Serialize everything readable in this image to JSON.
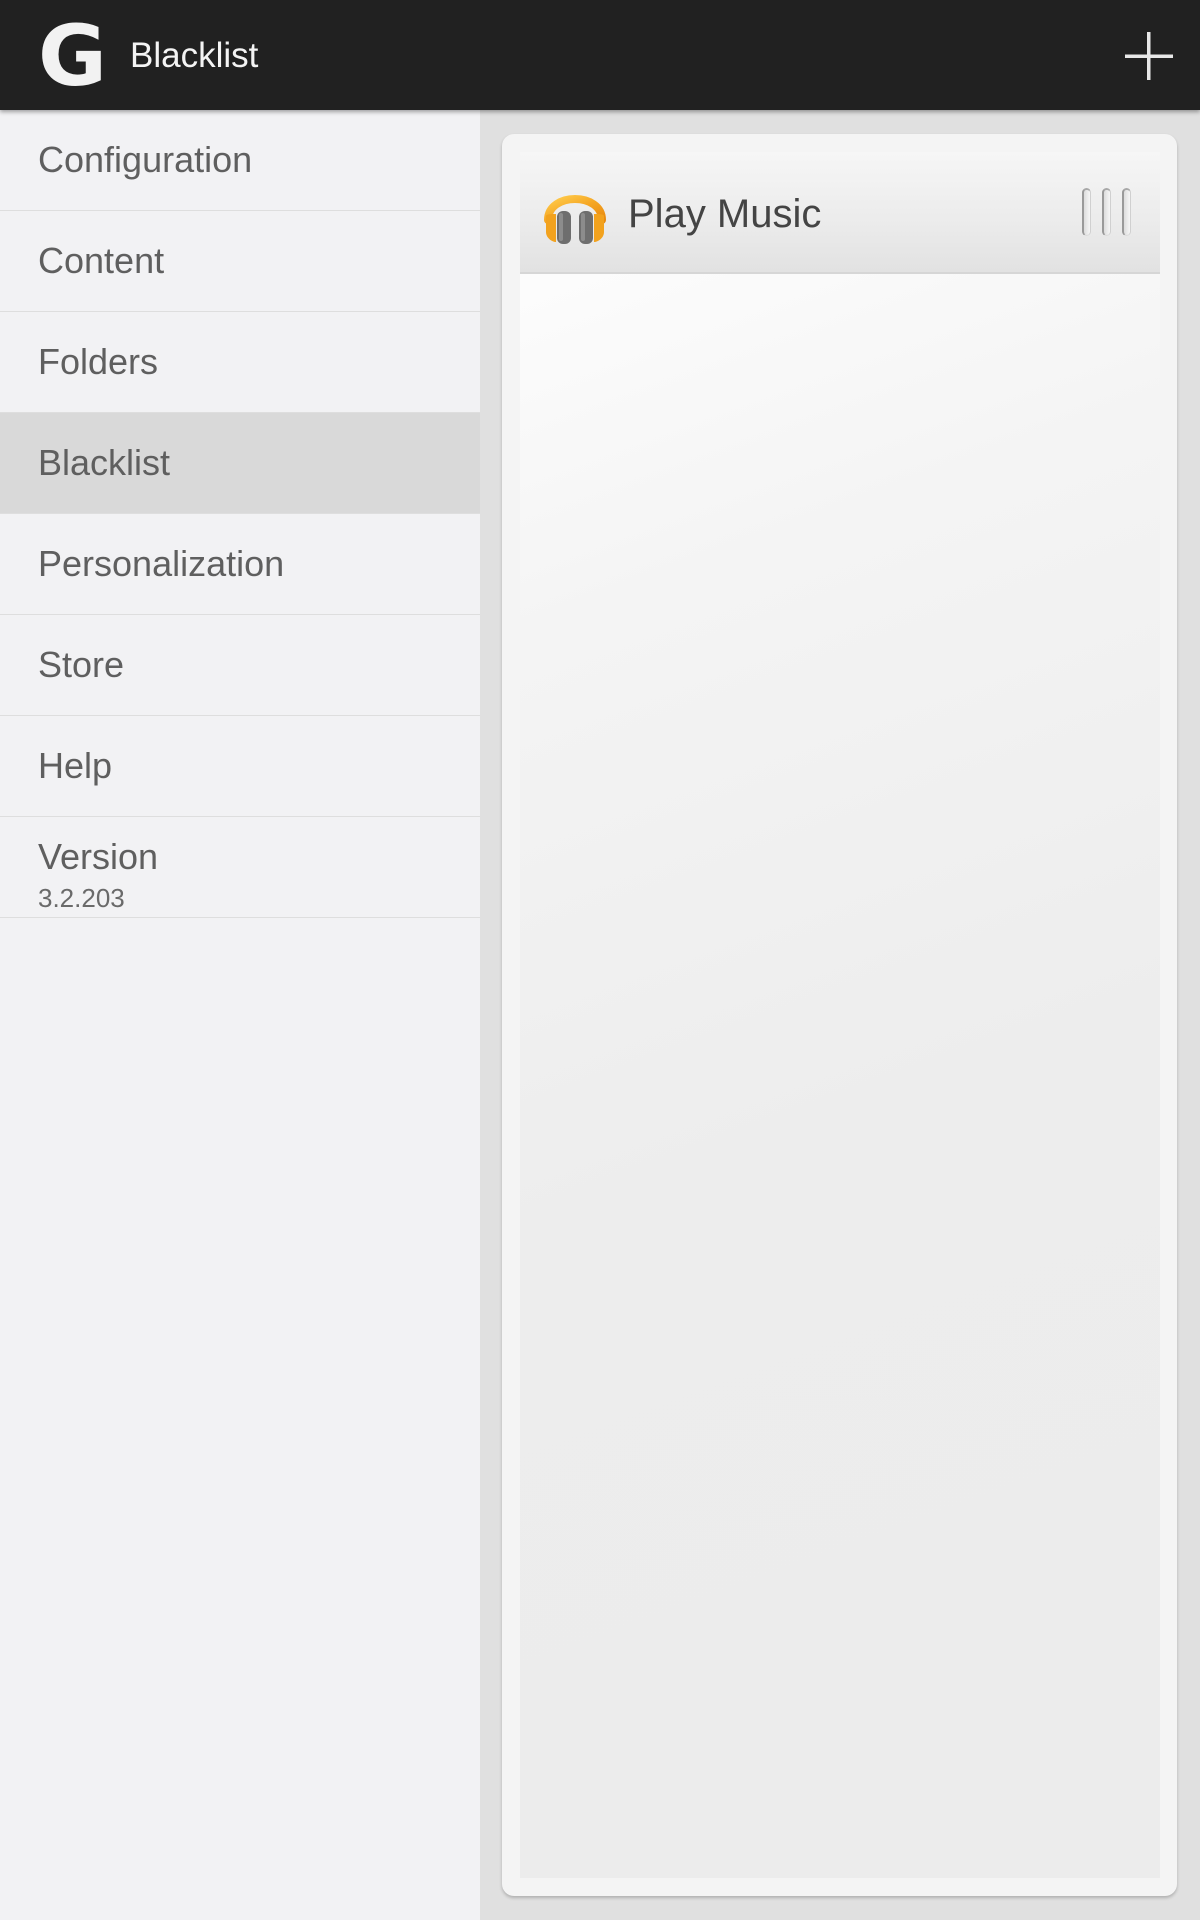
{
  "action_bar": {
    "logo_glyph": "G",
    "title": "Blacklist",
    "add_button_icon": "plus-icon"
  },
  "sidebar": {
    "items": [
      {
        "label": "Configuration",
        "selected": false
      },
      {
        "label": "Content",
        "selected": false
      },
      {
        "label": "Folders",
        "selected": false
      },
      {
        "label": "Blacklist",
        "selected": true
      },
      {
        "label": "Personalization",
        "selected": false
      },
      {
        "label": "Store",
        "selected": false
      },
      {
        "label": "Help",
        "selected": false
      }
    ],
    "version": {
      "label": "Version",
      "value": "3.2.203"
    }
  },
  "blacklist": {
    "items": [
      {
        "label": "Play Music",
        "icon": "headphones-icon"
      }
    ]
  },
  "colors": {
    "action_bar_bg": "#212121",
    "sidebar_bg": "#f2f2f4",
    "sidebar_selected_bg": "#d9d9d9",
    "accent_orange": "#f5a623"
  }
}
